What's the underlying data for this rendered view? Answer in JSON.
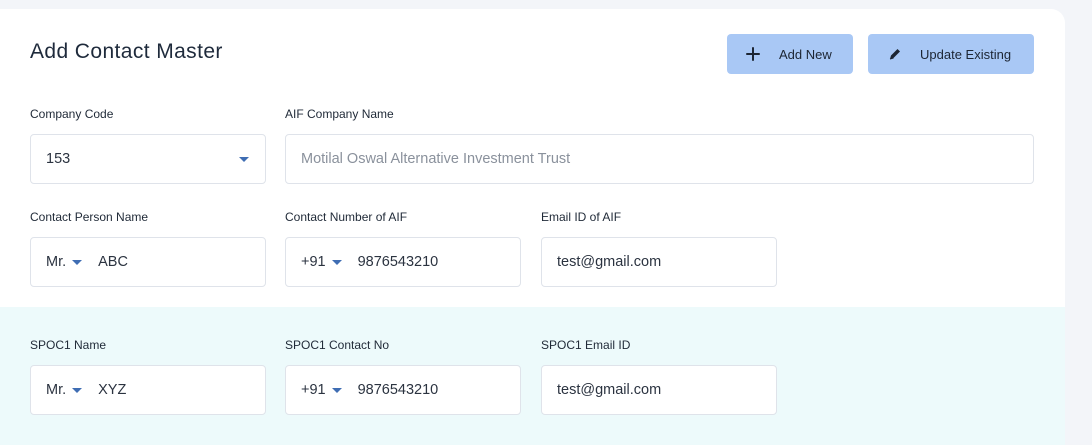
{
  "header": {
    "title": "Add Contact Master",
    "add_new_label": "Add New",
    "update_existing_label": "Update Existing"
  },
  "company": {
    "code_label": "Company Code",
    "code_value": "153",
    "name_label": "AIF Company Name",
    "name_value": "Motilal Oswal Alternative Investment Trust"
  },
  "contact": {
    "person_label": "Contact Person Name",
    "salutation": "Mr.",
    "person_value": "ABC",
    "number_label": "Contact Number of AIF",
    "country_code": "+91",
    "number_value": "9876543210",
    "email_label": "Email ID of AIF",
    "email_value": "test@gmail.com"
  },
  "spoc1": {
    "name_label": "SPOC1 Name",
    "salutation": "Mr.",
    "name_value": "XYZ",
    "contact_label": "SPOC1 Contact No",
    "country_code": "+91",
    "contact_value": "9876543210",
    "email_label": "SPOC1 Email ID",
    "email_value": "test@gmail.com"
  },
  "colors": {
    "button_bg": "#a9c8f5",
    "caret": "#3f6db3",
    "spoc_band": "#edfafb"
  },
  "icons": {
    "add": "plus-icon",
    "update": "pencil-icon",
    "dropdown": "caret-down-icon"
  }
}
